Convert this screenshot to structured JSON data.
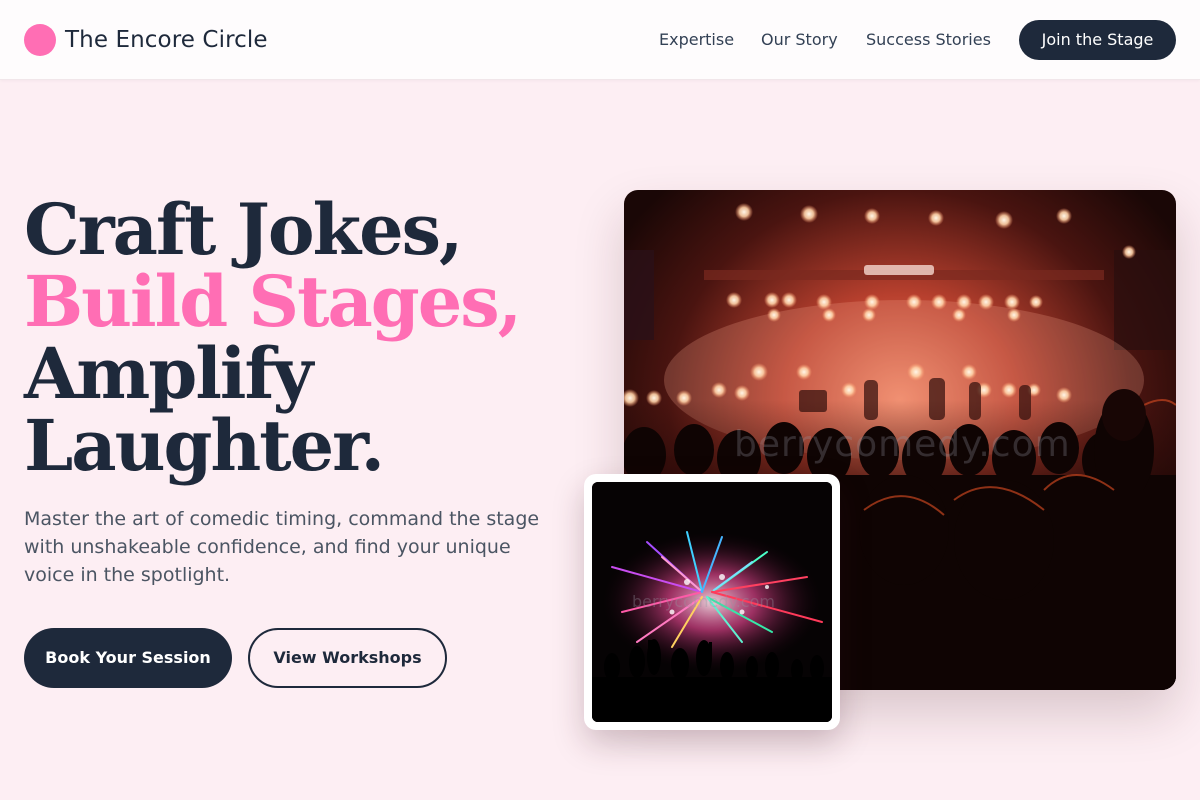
{
  "header": {
    "brand": "The Encore Circle",
    "nav": [
      "Expertise",
      "Our Story",
      "Success Stories"
    ],
    "cta": "Join the Stage"
  },
  "hero": {
    "headline_line1": "Craft Jokes,",
    "headline_line2": "Build Stages,",
    "headline_line3": "Amplify",
    "headline_line4": "Laughter.",
    "subtext": "Master the art of comedic timing, command the stage with unshakeable confidence, and find your unique voice in the spotlight.",
    "primary_button": "Book Your Session",
    "secondary_button": "View Workshops"
  },
  "images": {
    "main_watermark": "berrycomedy.com",
    "thumb_watermark": "berrycomedy.com"
  },
  "colors": {
    "accent_pink": "#ff6eb4",
    "navy": "#1e293b",
    "page_bg": "#fdeef3"
  },
  "icons": {
    "logo": "pink-circle-logo-icon"
  }
}
